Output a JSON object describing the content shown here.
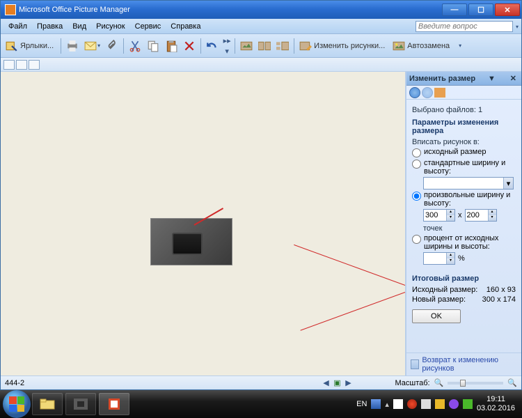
{
  "window": {
    "title": "Microsoft Office Picture Manager"
  },
  "menu": {
    "file": "Файл",
    "edit": "Правка",
    "view": "Вид",
    "picture": "Рисунок",
    "tools": "Сервис",
    "help": "Справка",
    "ask_placeholder": "Введите вопрос"
  },
  "toolbar": {
    "shortcuts": "Ярлыки...",
    "edit_pics": "Изменить рисунки...",
    "autofix": "Автозамена"
  },
  "panel": {
    "title": "Изменить размер",
    "selected": "Выбрано файлов: 1",
    "params_heading": "Параметры изменения размера",
    "fit_label": "Вписать рисунок в:",
    "opt_original": "исходный размер",
    "opt_standard": "стандартные ширину и высоту:",
    "opt_custom": "произвольные ширину и высоту:",
    "width": "300",
    "x_sep": "x",
    "height": "200",
    "pixels": "точек",
    "opt_percent": "процент от исходных ширины и высоты:",
    "percent_suffix": "%",
    "result_heading": "Итоговый размер",
    "orig_label": "Исходный размер:",
    "orig_val": "160 x 93",
    "new_label": "Новый размер:",
    "new_val": "300 x 174",
    "ok": "OK",
    "back_link": "Возврат к изменению рисунков"
  },
  "status": {
    "filename": "444-2",
    "zoom_label": "Масштаб:"
  },
  "taskbar": {
    "lang": "EN",
    "time": "19:11",
    "date": "03.02.2016"
  }
}
